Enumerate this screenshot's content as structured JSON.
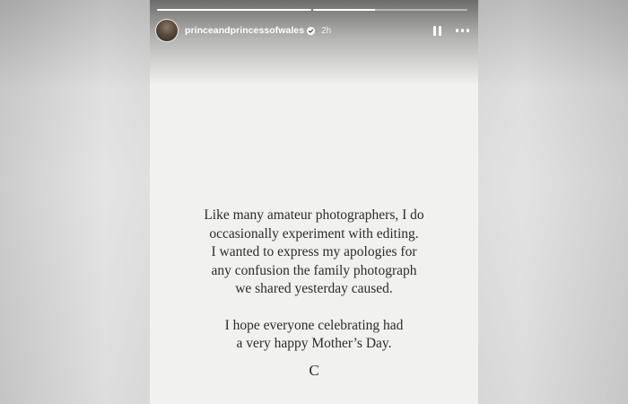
{
  "story": {
    "progress": [
      1.0,
      0.4
    ],
    "username": "princeandprincessofwales",
    "time": "2h",
    "icons": {
      "avatar": "profile-avatar",
      "verified": "verified-badge-icon",
      "pause": "pause-icon",
      "more": "more-options-icon"
    },
    "message": {
      "paragraph1": [
        "Like many amateur photographers, I do",
        "occasionally experiment with editing.",
        "I wanted to express my apologies for",
        "any confusion the family photograph",
        "we shared yesterday caused."
      ],
      "paragraph2": [
        "I hope everyone celebrating had",
        "a very happy Mother’s Day."
      ],
      "signature": "C"
    }
  }
}
